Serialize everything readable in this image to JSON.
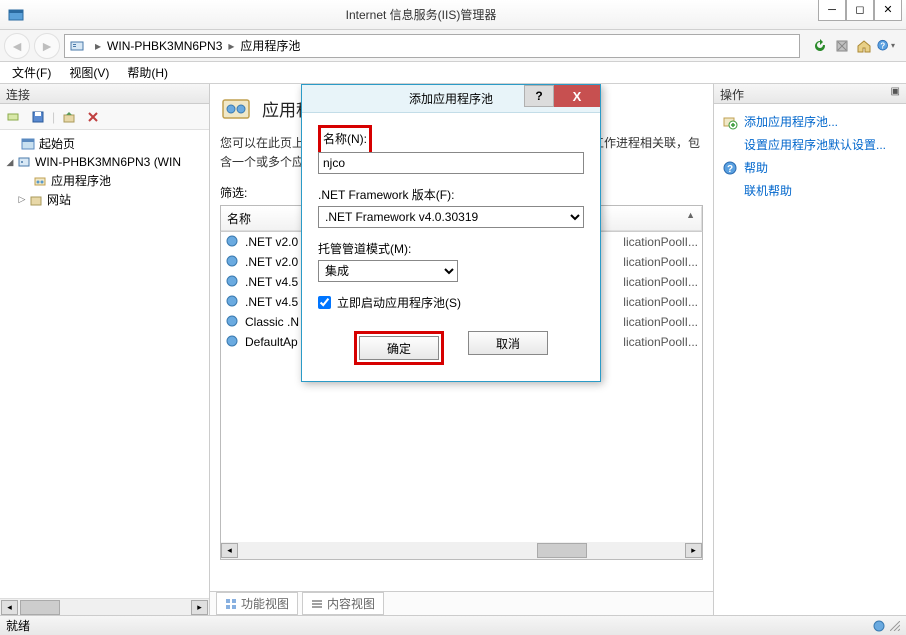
{
  "window": {
    "title": "Internet 信息服务(IIS)管理器"
  },
  "breadcrumb": {
    "server": "WIN-PHBK3MN6PN3",
    "node": "应用程序池"
  },
  "menus": {
    "file": "文件(F)",
    "view": "视图(V)",
    "help": "帮助(H)"
  },
  "connections": {
    "header": "连接",
    "start_page": "起始页",
    "server": "WIN-PHBK3MN6PN3 (WIN",
    "app_pools": "应用程序池",
    "sites": "网站"
  },
  "content": {
    "title": "应用程序池",
    "description": "您可以在此页上查看和管理服务器上的应用程序池列表。应用程序池与工作进程相关联，包含一个或多个应用程序，并提供不同应用程序之间的隔离。",
    "filter_label": "筛选:",
    "col_name": "名称",
    "rows": [
      {
        "name": ".NET v2.0",
        "extra": "licationPoolI..."
      },
      {
        "name": ".NET v2.0",
        "extra": "licationPoolI..."
      },
      {
        "name": ".NET v4.5",
        "extra": "licationPoolI..."
      },
      {
        "name": ".NET v4.5",
        "extra": "licationPoolI..."
      },
      {
        "name": "Classic .N",
        "extra": "licationPoolI..."
      },
      {
        "name": "DefaultAp",
        "extra": "licationPoolI..."
      }
    ],
    "view_features": "功能视图",
    "view_content": "内容视图"
  },
  "actions": {
    "header": "操作",
    "add_pool": "添加应用程序池...",
    "set_defaults": "设置应用程序池默认设置...",
    "help": "帮助",
    "online_help": "联机帮助"
  },
  "dialog": {
    "title": "添加应用程序池",
    "name_label": "名称(N):",
    "name_value": "njco",
    "framework_label": ".NET Framework 版本(F):",
    "framework_value": ".NET Framework v4.0.30319",
    "pipeline_label": "托管管道模式(M):",
    "pipeline_value": "集成",
    "autostart_label": "立即启动应用程序池(S)",
    "ok": "确定",
    "cancel": "取消"
  },
  "status": {
    "ready": "就绪"
  }
}
